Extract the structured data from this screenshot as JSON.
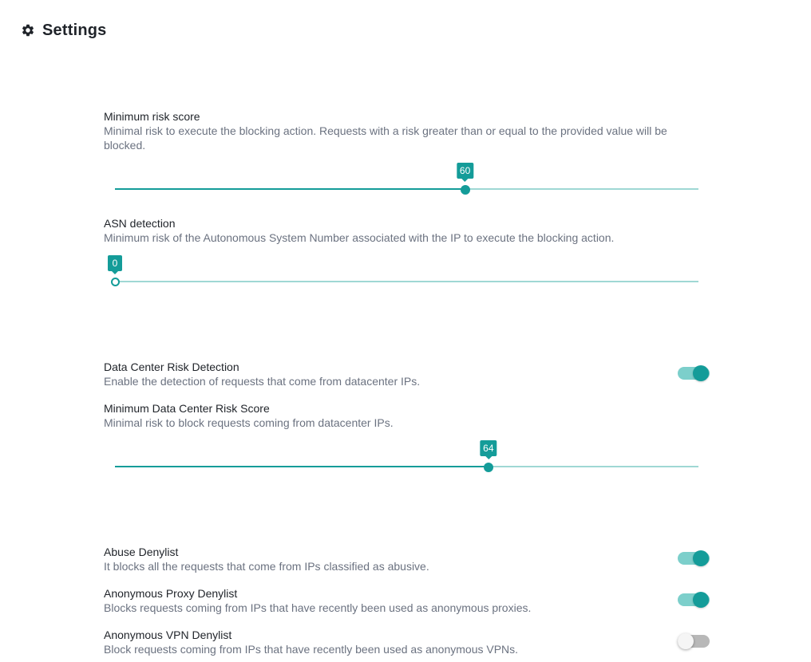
{
  "header": {
    "title": "Settings",
    "icon": "gear-icon"
  },
  "colors": {
    "accent": "#149c99",
    "accent_light": "#9fd8d4",
    "toggle_on_track": "#7ccfcb",
    "toggle_off_track": "#b8b8b8"
  },
  "settings": {
    "min_risk": {
      "label": "Minimum risk score",
      "description": "Minimal risk to execute the blocking action. Requests with a risk greater than or equal to the provided value will be blocked.",
      "value": 60,
      "value_label": "60",
      "min": 0,
      "max": 100
    },
    "asn": {
      "label": "ASN detection",
      "description": "Minimum risk of the Autonomous System Number associated with the IP to execute the blocking action.",
      "value": 0,
      "value_label": "0",
      "min": 0,
      "max": 100
    },
    "datacenter": {
      "label": "Data Center Risk Detection",
      "description": "Enable the detection of requests that come from datacenter IPs.",
      "enabled": true
    },
    "min_datacenter": {
      "label": "Minimum Data Center Risk Score",
      "description": "Minimal risk to block requests coming from datacenter IPs.",
      "value": 64,
      "value_label": "64",
      "min": 0,
      "max": 100
    },
    "abuse": {
      "label": "Abuse Denylist",
      "description": "It blocks all the requests that come from IPs classified as abusive.",
      "enabled": true
    },
    "proxy": {
      "label": "Anonymous Proxy Denylist",
      "description": "Blocks requests coming from IPs that have recently been used as anonymous proxies.",
      "enabled": true
    },
    "vpn": {
      "label": "Anonymous VPN Denylist",
      "description": "Block requests coming from IPs that have recently been used as anonymous VPNs.",
      "enabled": false
    }
  }
}
